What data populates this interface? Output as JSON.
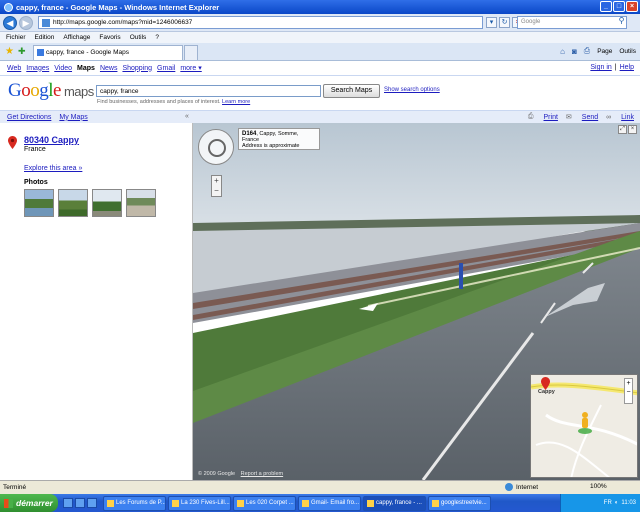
{
  "window": {
    "title": "cappy, france - Google Maps - Windows Internet Explorer",
    "buttons": [
      "_",
      "□",
      "×"
    ]
  },
  "address_bar": {
    "url": "http://maps.google.com/maps?mid=1246006637",
    "search_placeholder": "Google"
  },
  "menu": [
    "Fichier",
    "Edition",
    "Affichage",
    "Favoris",
    "Outils",
    "?"
  ],
  "tabs": {
    "active_label": "cappy, france - Google Maps"
  },
  "command_bar": {
    "page_label": "Page",
    "tools_label": "Outils"
  },
  "google_bar": {
    "links": [
      "Web",
      "Images",
      "Video"
    ],
    "current": "Maps",
    "links2": [
      "News",
      "Shopping",
      "Gmail"
    ],
    "more": "more ▾",
    "sign_in": "Sign in",
    "help": "Help",
    "separator": "|"
  },
  "search": {
    "value": "cappy, france",
    "button_label": "Search Maps",
    "options_link": "Show search options",
    "hint": "Find businesses, addresses and places of interest.",
    "hint_link": "Learn more"
  },
  "sidebar": {
    "get_directions": "Get Directions",
    "my_maps": "My Maps",
    "collapse": "«",
    "place_title": "80340 Cappy",
    "place_country": "France",
    "explore_link": "Explore this area »",
    "photos_label": "Photos"
  },
  "map_header": {
    "print": "Print",
    "send": "Send",
    "link": "Link"
  },
  "streetview": {
    "road": "D164",
    "location": ", Cappy, Somme, France",
    "approx_note": "Address is approximate",
    "copyright": "© 2009 Google",
    "report": "Report a problem",
    "zoom_in": "+",
    "zoom_out": "−",
    "minimap_label": "Cappy"
  },
  "status_bar": {
    "status": "Terminé",
    "zone": "Internet",
    "zoom": "100%"
  },
  "taskbar": {
    "start": "démarrer",
    "tasks": [
      "Les Forums de P...",
      "La 230 Fives-Lill...",
      "Les 020 Corpet ...",
      "Gmail- Email fro...",
      "cappy, france - ...",
      "googlestreetvie..."
    ],
    "active_index": 4,
    "lang": "FR",
    "clock": "11:03"
  },
  "colors": {
    "link": "#1c1cbf",
    "xp_blue": "#0a47c7",
    "start_green": "#2f8f2f"
  }
}
